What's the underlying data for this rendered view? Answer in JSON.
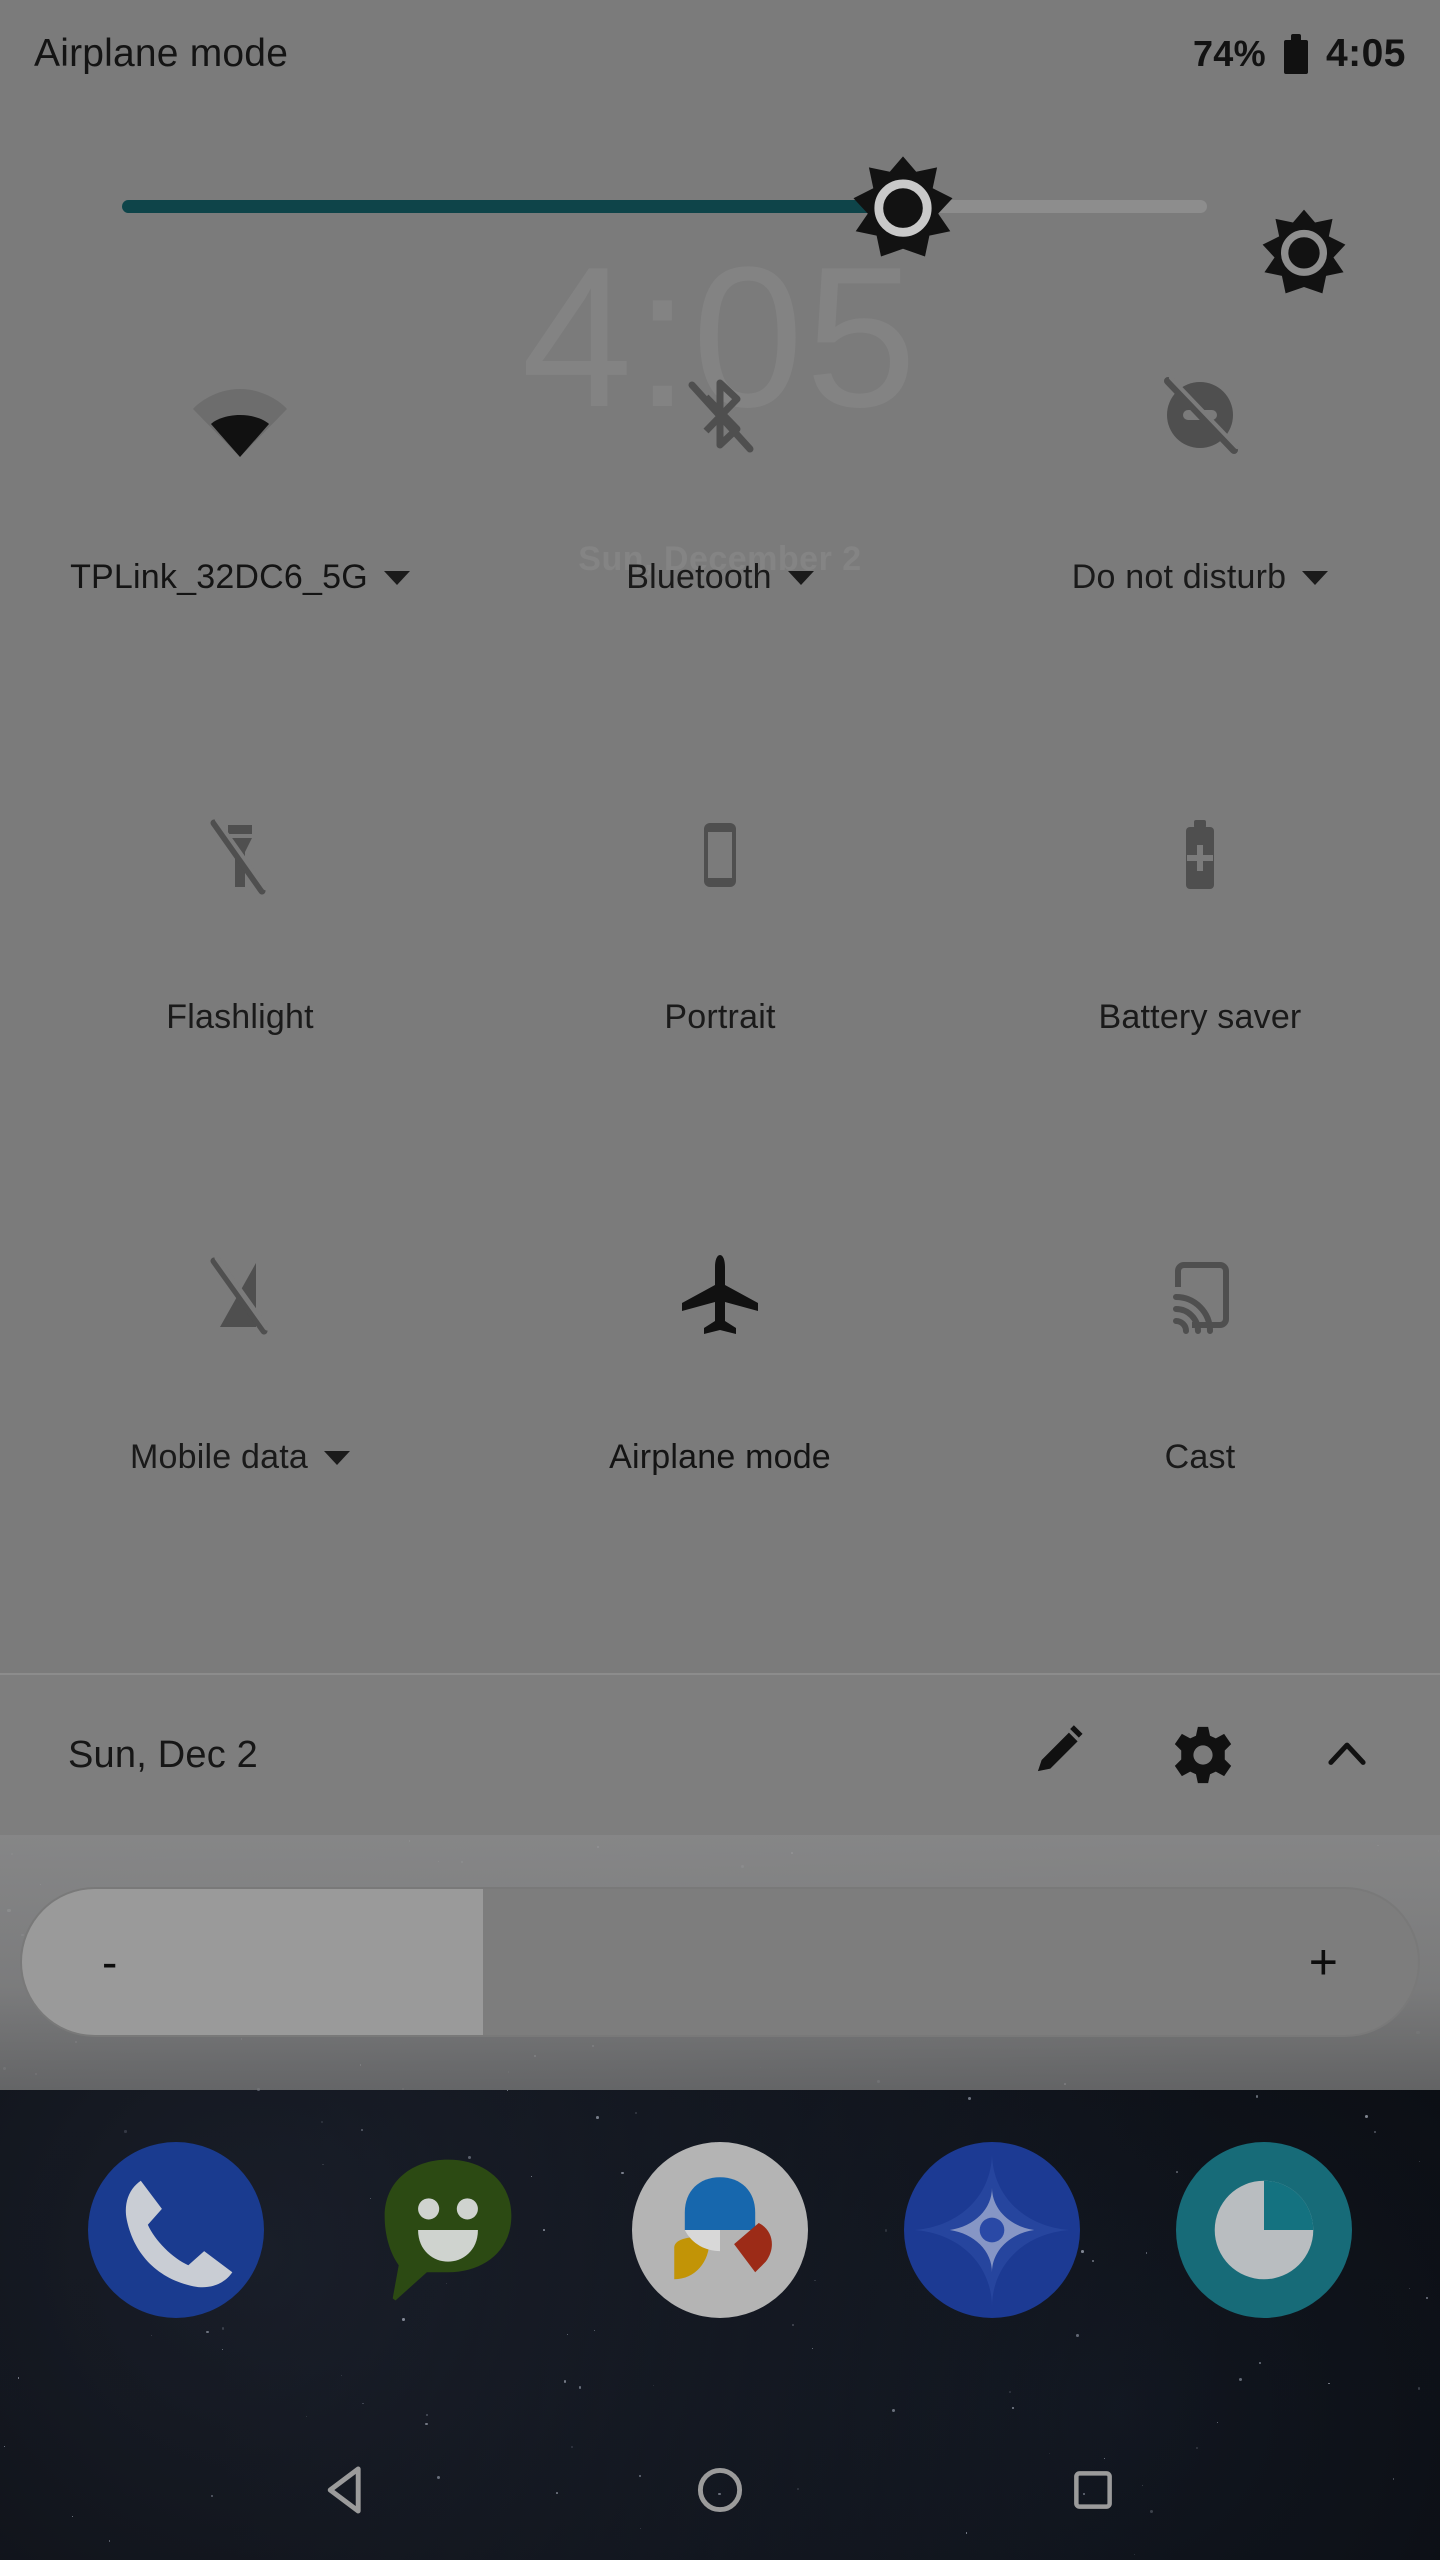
{
  "status_bar": {
    "left_text": "Airplane mode",
    "battery_percent": "74%",
    "battery_icon": "battery-full-icon",
    "clock": "4:05"
  },
  "lockscreen_watermark": {
    "clock": "4:05",
    "date": "Sun, December 2"
  },
  "brightness": {
    "slider_name": "brightness-slider",
    "fill_percent": 72,
    "thumb_icon": "brightness-sun-icon",
    "auto_icon": "auto-brightness-sun-icon"
  },
  "tiles": [
    [
      {
        "label": "TPLink_32DC6_5G",
        "icon": "wifi-icon",
        "state": "on",
        "has_caret": true
      },
      {
        "label": "Bluetooth",
        "icon": "bluetooth-off-icon",
        "state": "off",
        "has_caret": true
      },
      {
        "label": "Do not disturb",
        "icon": "do-not-disturb-off-icon",
        "state": "off",
        "has_caret": true
      }
    ],
    [
      {
        "label": "Flashlight",
        "icon": "flashlight-off-icon",
        "state": "off",
        "has_caret": false
      },
      {
        "label": "Portrait",
        "icon": "rotation-portrait-icon",
        "state": "off",
        "has_caret": false
      },
      {
        "label": "Battery saver",
        "icon": "battery-saver-icon",
        "state": "off",
        "has_caret": false
      }
    ],
    [
      {
        "label": "Mobile data",
        "icon": "mobile-data-off-icon",
        "state": "off",
        "has_caret": true
      },
      {
        "label": "Airplane mode",
        "icon": "airplane-icon",
        "state": "on",
        "has_caret": false
      },
      {
        "label": "Cast",
        "icon": "cast-icon",
        "state": "off",
        "has_caret": false
      }
    ]
  ],
  "footer": {
    "date": "Sun, Dec 2",
    "edit_icon": "pencil-edit-icon",
    "settings_icon": "gear-icon",
    "collapse_icon": "chevron-up-icon"
  },
  "notification_pill": {
    "minus_label": "-",
    "plus_label": "+",
    "fill_percent": 33
  },
  "dock": [
    {
      "name": "phone-app",
      "color": "#1a3b8f"
    },
    {
      "name": "messages-app",
      "color": "#2c4a13"
    },
    {
      "name": "photos-app",
      "color": "#b8b8b8"
    },
    {
      "name": "google-app",
      "color": "#1c3a93"
    },
    {
      "name": "camera-app",
      "color": "#176b78"
    }
  ],
  "nav_bar": {
    "back": "back-triangle-icon",
    "home": "home-circle-icon",
    "recents": "recents-square-icon"
  },
  "colors": {
    "panel_bg": "#7b7b7b",
    "brightness_fill": "#0e4449",
    "icon_on": "#111111",
    "icon_off": "#4b4b4b"
  }
}
